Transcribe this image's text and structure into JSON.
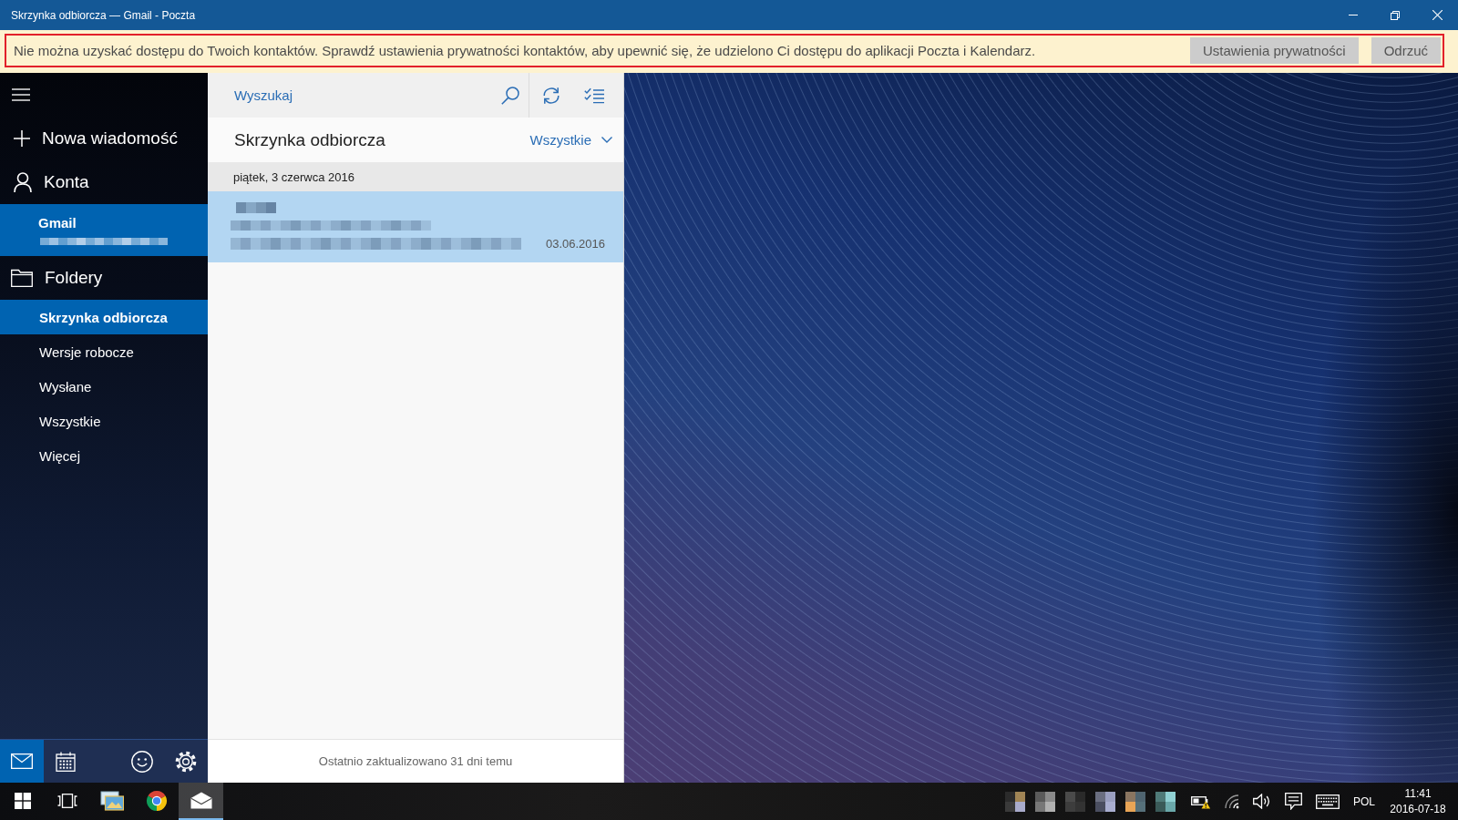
{
  "window": {
    "title": "Skrzynka odbiorcza — Gmail - Poczta"
  },
  "notification": {
    "message": "Nie można uzyskać dostępu do Twoich kontaktów. Sprawdź ustawienia prywatności kontaktów, aby upewnić się, że udzielono Ci dostępu do aplikacji Poczta i Kalendarz.",
    "buttons": [
      "Ustawienia prywatności",
      "Odrzuć"
    ]
  },
  "sidebar": {
    "new_message": "Nowa wiadomość",
    "accounts_label": "Konta",
    "accounts": [
      {
        "name": "Gmail",
        "selected": true
      }
    ],
    "folders_label": "Foldery",
    "folders": [
      {
        "label": "Skrzynka odbiorcza",
        "selected": true
      },
      {
        "label": "Wersje robocze",
        "selected": false
      },
      {
        "label": "Wysłane",
        "selected": false
      },
      {
        "label": "Wszystkie",
        "selected": false
      },
      {
        "label": "Więcej",
        "selected": false
      }
    ],
    "bottom_nav": {
      "apps": [
        {
          "kind": "mail",
          "selected": true
        },
        {
          "kind": "calendar",
          "selected": false
        }
      ],
      "actions": [
        {
          "kind": "feedback"
        },
        {
          "kind": "settings"
        }
      ]
    }
  },
  "message_list": {
    "search": {
      "placeholder": "Wyszukaj"
    },
    "folder_title": "Skrzynka odbiorcza",
    "filter": "Wszystkie",
    "groups": [
      {
        "date": "piątek, 3 czerwca 2016",
        "messages": [
          {
            "date": "03.06.2016",
            "selected": true
          }
        ]
      }
    ],
    "status": "Ostatnio zaktualizowano 31 dni temu"
  },
  "taskbar": {
    "buttons": [
      {
        "kind": "start",
        "active": false
      },
      {
        "kind": "task_view",
        "active": false
      },
      {
        "kind": "photos",
        "active": false
      },
      {
        "kind": "browser",
        "active": false
      },
      {
        "kind": "mail",
        "active": true
      }
    ],
    "tray": {
      "language": "POL",
      "time": "11:41",
      "date": "2016-07-18"
    }
  }
}
